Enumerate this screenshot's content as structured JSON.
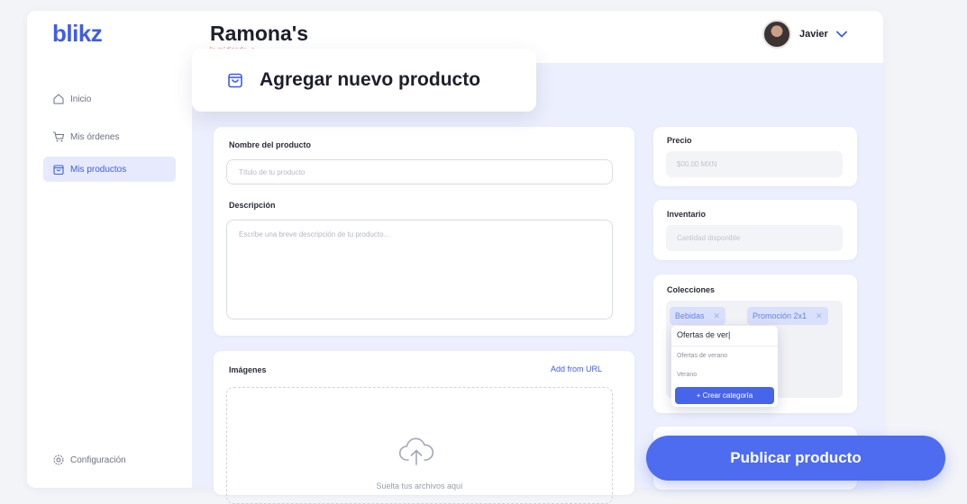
{
  "brand": {
    "logo": "blikz"
  },
  "store": {
    "name": "Ramona's",
    "subtitle": "la mi tienda ✓"
  },
  "user": {
    "name": "Javier"
  },
  "sidebar": {
    "items": [
      {
        "label": "Inicio",
        "icon": "home-icon"
      },
      {
        "label": "Mis órdenes",
        "icon": "cart-icon"
      },
      {
        "label": "Mis productos",
        "icon": "bag-icon",
        "active": true
      }
    ],
    "settings": {
      "label": "Configuración",
      "icon": "gear-icon"
    }
  },
  "page": {
    "title": "Agregar nuevo producto"
  },
  "form": {
    "name_label": "Nombre del producto",
    "name_placeholder": "Título de tu producto",
    "description_label": "Descripción",
    "description_placeholder": "Escribe una breve descripción de tu producto...",
    "images_label": "Imágenes",
    "add_url_link": "Add from URL",
    "dropzone_text": "Suelta tus archivos aquí"
  },
  "side_panel": {
    "price_label": "Precio",
    "price_placeholder": "$00.00 MXN",
    "inventory_label": "Inventario",
    "inventory_placeholder": "Cantidad disponible",
    "collections_label": "Colecciones",
    "tags": [
      "Bebidas",
      "Promoción 2x1"
    ],
    "dropdown": {
      "input_value": "Ofertas de ver|",
      "options": [
        "Ofertas de verano",
        "Verano"
      ],
      "create_button": "+ Crear categoría"
    }
  },
  "actions": {
    "publish": "Publicar producto"
  },
  "colors": {
    "accent": "#3f5de6",
    "button": "#4d6cf0",
    "canvas": "#eceffd"
  }
}
